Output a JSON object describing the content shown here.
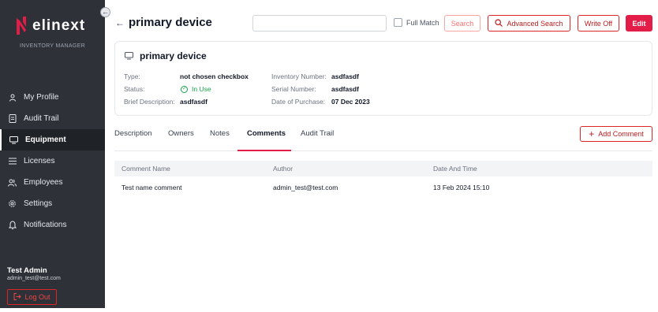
{
  "sidebar": {
    "logo_text": "elinext",
    "subtitle": "INVENTORY MANAGER",
    "collapse_icon": "arrow-left-icon",
    "items": [
      {
        "label": "My Profile",
        "icon": "user-icon"
      },
      {
        "label": "Audit Trail",
        "icon": "document-icon"
      },
      {
        "label": "Equipment",
        "icon": "monitor-icon",
        "active": true
      },
      {
        "label": "Licenses",
        "icon": "list-icon"
      },
      {
        "label": "Employees",
        "icon": "users-icon"
      },
      {
        "label": "Settings",
        "icon": "gear-icon"
      },
      {
        "label": "Notifications",
        "icon": "bell-icon"
      }
    ],
    "user_name": "Test Admin",
    "user_email": "admin_test@test.com",
    "logout_label": "Log Out"
  },
  "header": {
    "title": "primary device",
    "search_value": "",
    "full_match_label": "Full Match",
    "search_label": "Search",
    "advanced_search_label": "Advanced Search",
    "write_off_label": "Write Off",
    "edit_label": "Edit"
  },
  "card": {
    "title": "primary device",
    "type_label": "Type:",
    "type_value": "not chosen checkbox",
    "status_label": "Status:",
    "status_value": "In Use",
    "brief_label": "Brief Description:",
    "brief_value": "asdfasdf",
    "inventory_label": "Inventory Number:",
    "inventory_value": "asdfasdf",
    "serial_label": "Serial Number:",
    "serial_value": "asdfasdf",
    "purchase_label": "Date of Purchase:",
    "purchase_value": "07 Dec 2023"
  },
  "tabs": [
    "Description",
    "Owners",
    "Notes",
    "Comments",
    "Audit Trail"
  ],
  "active_tab": "Comments",
  "add_comment_label": "Add Comment",
  "table": {
    "headers": [
      "Comment Name",
      "Author",
      "Date And Time"
    ],
    "rows": [
      [
        "Test name comment",
        "admin_test@test.com",
        "13 Feb 2024 15:10"
      ]
    ]
  },
  "colors": {
    "accent": "#e11d48",
    "sidebar_bg": "#2e3238",
    "status_green": "#16a34a"
  }
}
